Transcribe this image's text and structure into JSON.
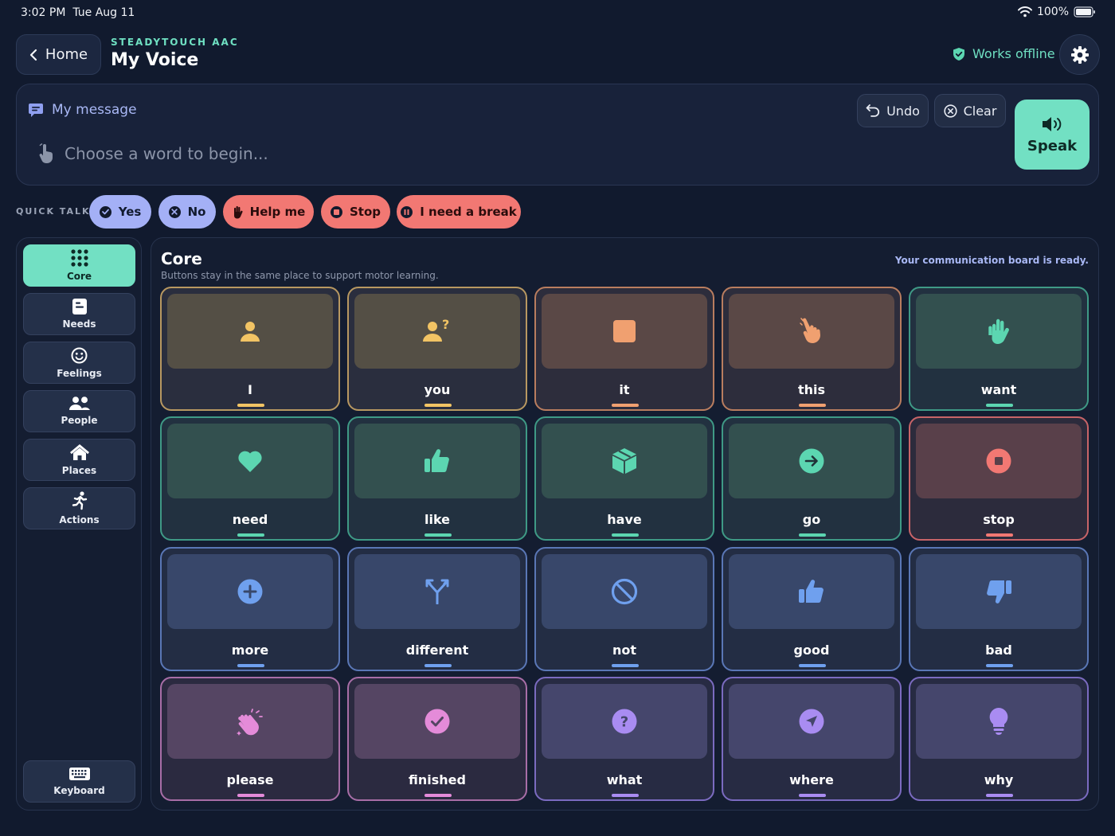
{
  "status": {
    "time": "3:02 PM",
    "date": "Tue Aug 11",
    "battery": "100%"
  },
  "header": {
    "back_label": "Home",
    "brand": "STEADYTOUCH AAC",
    "title": "My Voice",
    "offline_label": "Works offline"
  },
  "message": {
    "label": "My message",
    "placeholder": "Choose a word to begin...",
    "undo_label": "Undo",
    "clear_label": "Clear",
    "speak_label": "Speak"
  },
  "quick_talk": {
    "label": "QUICK TALK",
    "items": [
      {
        "label": "Yes"
      },
      {
        "label": "No"
      },
      {
        "label": "Help me"
      },
      {
        "label": "Stop"
      },
      {
        "label": "I need a break"
      }
    ]
  },
  "sidebar": {
    "items": [
      {
        "label": "Core",
        "icon": "grid-icon",
        "active": true
      },
      {
        "label": "Needs",
        "icon": "needs-icon"
      },
      {
        "label": "Feelings",
        "icon": "smile-icon"
      },
      {
        "label": "People",
        "icon": "people-icon"
      },
      {
        "label": "Places",
        "icon": "house-icon"
      },
      {
        "label": "Actions",
        "icon": "running-icon"
      }
    ],
    "keyboard_label": "Keyboard"
  },
  "board": {
    "title": "Core",
    "subtitle": "Buttons stay in the same place to support motor learning.",
    "status": "Your communication board is ready.",
    "words": [
      {
        "word": "I",
        "color": "#f2c464",
        "icon": "person-icon"
      },
      {
        "word": "you",
        "color": "#f2c464",
        "icon": "person-question-icon"
      },
      {
        "word": "it",
        "color": "#f0a070",
        "icon": "square-icon"
      },
      {
        "word": "this",
        "color": "#f0a070",
        "icon": "pointing-hand-icon"
      },
      {
        "word": "want",
        "color": "#5cd6b1",
        "icon": "open-hand-icon"
      },
      {
        "word": "need",
        "color": "#5cd6b1",
        "icon": "heart-icon"
      },
      {
        "word": "like",
        "color": "#5cd6b1",
        "icon": "thumbs-up-icon"
      },
      {
        "word": "have",
        "color": "#5cd6b1",
        "icon": "box-icon"
      },
      {
        "word": "go",
        "color": "#5cd6b1",
        "icon": "arrow-right-icon"
      },
      {
        "word": "stop",
        "color": "#f27873",
        "icon": "stop-icon"
      },
      {
        "word": "more",
        "color": "#6fa0ee",
        "icon": "plus-icon"
      },
      {
        "word": "different",
        "color": "#6fa0ee",
        "icon": "split-arrows-icon"
      },
      {
        "word": "not",
        "color": "#6fa0ee",
        "icon": "ban-icon"
      },
      {
        "word": "good",
        "color": "#6fa0ee",
        "icon": "thumbs-up-icon"
      },
      {
        "word": "bad",
        "color": "#6fa0ee",
        "icon": "thumbs-down-icon"
      },
      {
        "word": "please",
        "color": "#e48bd9",
        "icon": "clapping-hands-icon"
      },
      {
        "word": "finished",
        "color": "#e48bd9",
        "icon": "check-icon"
      },
      {
        "word": "what",
        "color": "#a98cf2",
        "icon": "question-icon"
      },
      {
        "word": "where",
        "color": "#a98cf2",
        "icon": "location-arrow-icon"
      },
      {
        "word": "why",
        "color": "#a98cf2",
        "icon": "lightbulb-icon"
      }
    ]
  }
}
